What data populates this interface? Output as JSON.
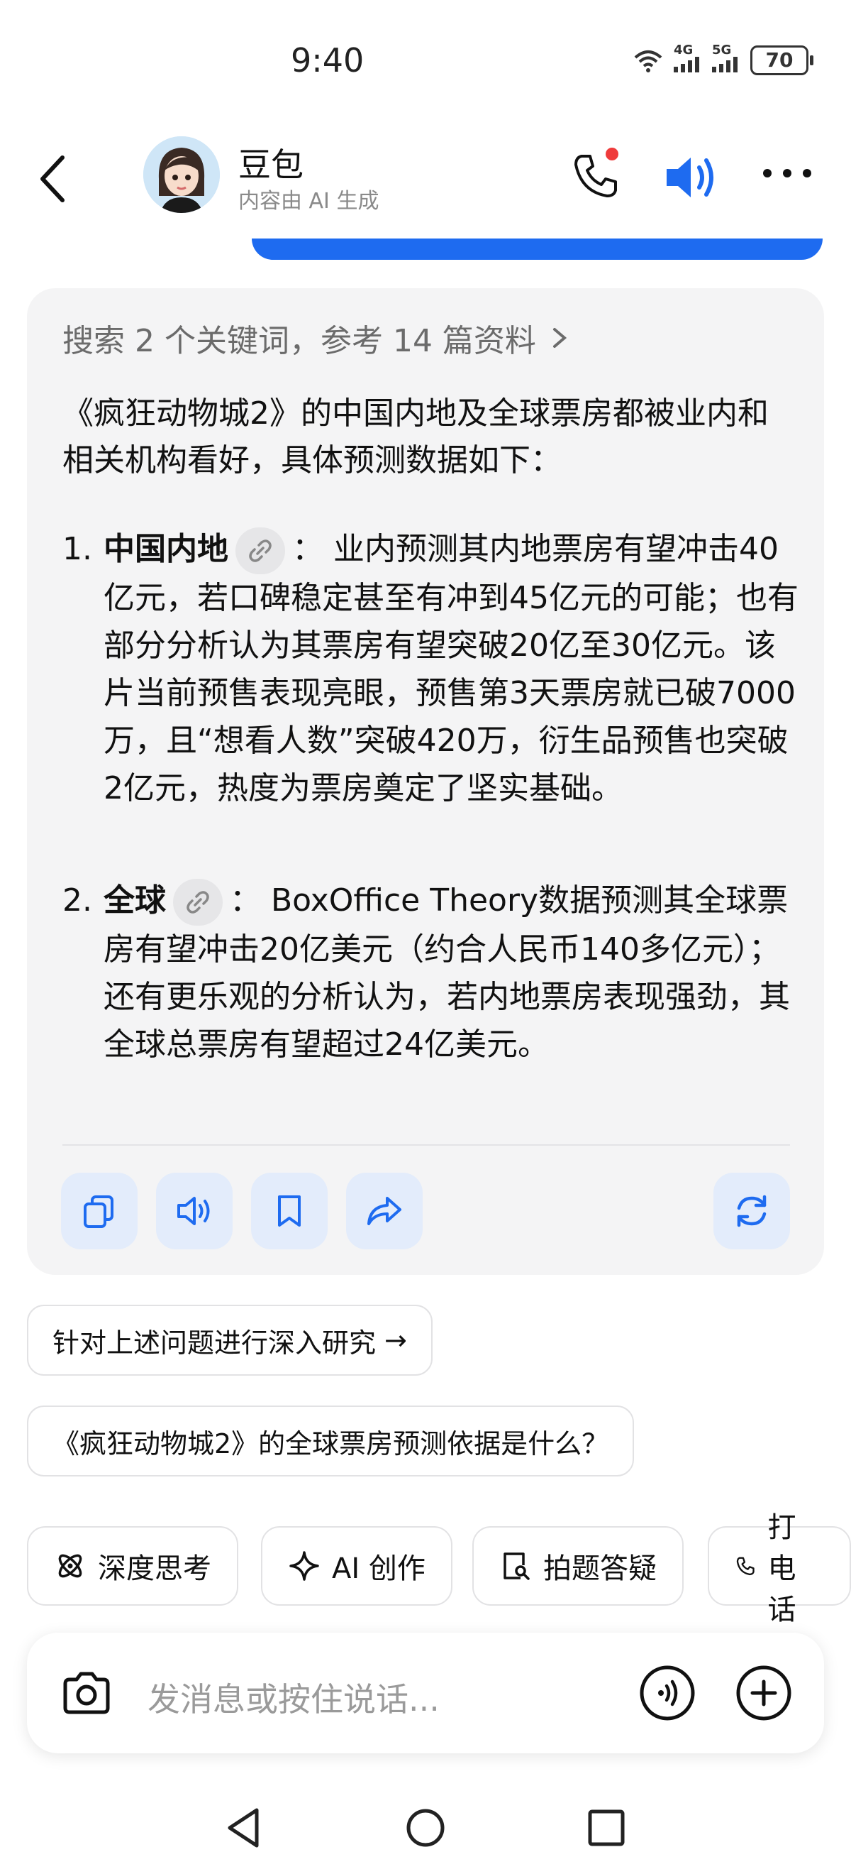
{
  "status_bar": {
    "time": "9:40",
    "network1": "4G",
    "network2": "5G",
    "battery": "70"
  },
  "header": {
    "title": "豆包",
    "subtitle": "内容由 AI 生成"
  },
  "answer": {
    "search_summary": "搜索 2 个关键词，参考 14 篇资料",
    "intro": "《疯狂动物城2》的中国内地及全球票房都被业内和相关机构看好，具体预测数据如下：",
    "items": [
      {
        "num": "1.",
        "heading": "中国内地",
        "text": "：  业内预测其内地票房有望冲击40亿元，若口碑稳定甚至有冲到45亿元的可能；也有部分分析认为其票房有望突破20亿至30亿元。该片当前预售表现亮眼，预售第3天票房就已破7000万，且“想看人数”突破420万，衍生品预售也突破2亿元，热度为票房奠定了坚实基础。"
      },
      {
        "num": "2.",
        "heading": "全球",
        "text": "：  BoxOffice Theory数据预测其全球票房有望冲击20亿美元（约合人民币140多亿元）；  还有更乐观的分析认为，若内地票房表现强劲，其全球总票房有望超过24亿美元。"
      }
    ]
  },
  "suggestions": [
    {
      "label": "针对上述问题进行深入研究",
      "arrow": "→"
    },
    {
      "label": "《疯狂动物城2》的全球票房预测依据是什么？",
      "arrow": ""
    }
  ],
  "tools": [
    {
      "label": "深度思考",
      "icon": "atom-icon"
    },
    {
      "label": "AI 创作",
      "icon": "sparkle-icon"
    },
    {
      "label": "拍题答疑",
      "icon": "doc-search-icon"
    },
    {
      "label": "打电话",
      "icon": "phone-icon"
    }
  ],
  "input": {
    "placeholder": "发消息或按住说话..."
  },
  "colors": {
    "accent": "#1e6bf0",
    "card_bg": "#f4f4f5",
    "notification": "#ef3b3b"
  }
}
